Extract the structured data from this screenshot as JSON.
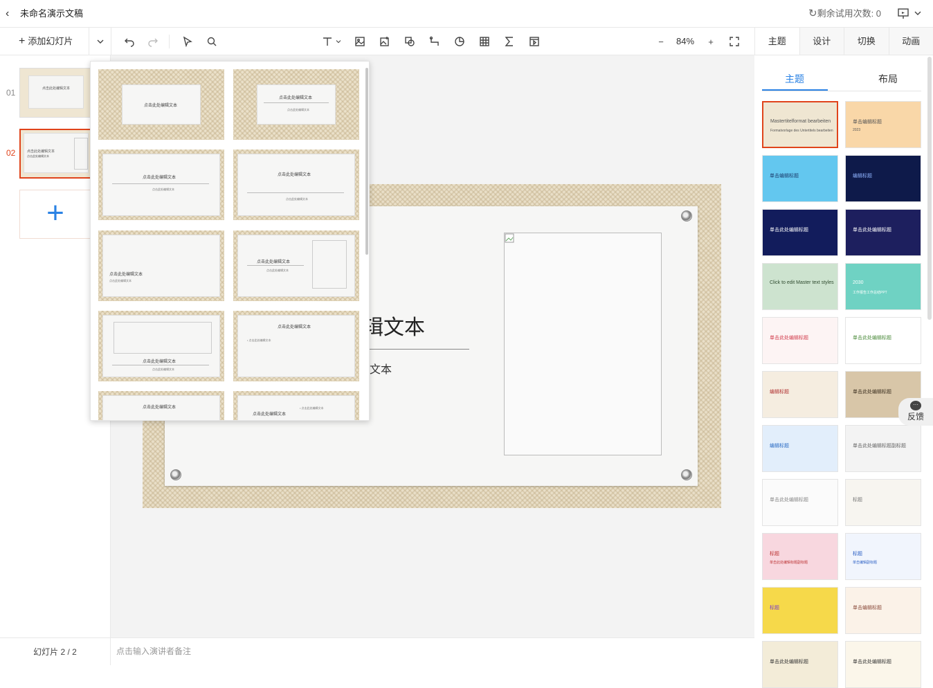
{
  "header": {
    "back_icon": "‹",
    "title": "未命名演示文稿",
    "trial_text": "剩余试用次数: 0",
    "refresh_icon": "↻",
    "present_icon": "present-icon"
  },
  "toolbar": {
    "add_slide_label": "添加幻灯片",
    "plus": "+",
    "zoom_minus": "−",
    "zoom_value": "84%",
    "zoom_plus": "+"
  },
  "right_tabs": [
    "主题",
    "设计",
    "切换",
    "动画"
  ],
  "right_subtabs": [
    "主题",
    "布局"
  ],
  "slides": [
    {
      "num": "01",
      "thumb_text": "点击此处编辑文本"
    },
    {
      "num": "02",
      "thumb_text": "点击此处编辑文本",
      "thumb_sub": "点击此处编辑文本"
    }
  ],
  "add_slide_plus": "+",
  "status": "幻灯片 2 / 2",
  "notes_placeholder": "点击输入演讲者备注",
  "slide": {
    "title_partial": "辑文本",
    "subtitle_partial": "文本"
  },
  "layouts": {
    "title": "点击此处编辑文本",
    "sub": "点击此处编辑文本",
    "bullet": "• 点击此处编辑文本"
  },
  "themes": [
    {
      "title": "Mastertitelformat bearbeiten",
      "sub": "Formatvorlage des Untertitels bearbeiten",
      "bg": "#efe6d2",
      "fg": "#555"
    },
    {
      "title": "单击编辑标题",
      "sub": "2023",
      "bg": "#f9d7a8",
      "fg": "#555"
    },
    {
      "title": "单击编辑标题",
      "sub": "",
      "bg": "#63c7ef",
      "fg": "#1b3b6b"
    },
    {
      "title": "编辑标题",
      "sub": "",
      "bg": "#0e1a4a",
      "fg": "#8fb4ff"
    },
    {
      "title": "单击此处编辑标题",
      "sub": "",
      "bg": "#121c5c",
      "fg": "#fff"
    },
    {
      "title": "单击此处编辑标题",
      "sub": "",
      "bg": "#1d1f5e",
      "fg": "#fff"
    },
    {
      "title": "Click to edit Master text styles",
      "sub": "",
      "bg": "#cde3cf",
      "fg": "#2e4a2e"
    },
    {
      "title": "2030",
      "sub": "工作报告工作总结PPT",
      "bg": "#6fd2c3",
      "fg": "#fff"
    },
    {
      "title": "单击此处编辑标题",
      "sub": "",
      "bg": "#fdf4f4",
      "fg": "#d23a4a"
    },
    {
      "title": "单击此处编辑标题",
      "sub": "",
      "bg": "#ffffff",
      "fg": "#4a8a3a"
    },
    {
      "title": "编辑标题",
      "sub": "",
      "bg": "#f5ede0",
      "fg": "#b03030"
    },
    {
      "title": "单击此处编辑标题",
      "sub": "",
      "bg": "#d8c6a8",
      "fg": "#3a2e1e"
    },
    {
      "title": "编辑标题",
      "sub": "",
      "bg": "#e2eefb",
      "fg": "#2a6bc4"
    },
    {
      "title": "单击此处编辑标题副标题",
      "sub": "",
      "bg": "#f3f3f3",
      "fg": "#666"
    },
    {
      "title": "单击此处编辑标题",
      "sub": "",
      "bg": "#fbfbfb",
      "fg": "#888"
    },
    {
      "title": "标题",
      "sub": "",
      "bg": "#f7f5f0",
      "fg": "#777"
    },
    {
      "title": "标题",
      "sub": "单击此处编辑标题副标题",
      "bg": "#f8d7df",
      "fg": "#b33"
    },
    {
      "title": "标题",
      "sub": "单击编辑副标题",
      "bg": "#f1f5fd",
      "fg": "#2a5fc4"
    },
    {
      "title": "标题",
      "sub": "",
      "bg": "#f6d94a",
      "fg": "#7a3ad0"
    },
    {
      "title": "单击编辑标题",
      "sub": "",
      "bg": "#fbf2e8",
      "fg": "#8a4a3a"
    },
    {
      "title": "单击此处编辑标题",
      "sub": "",
      "bg": "#f3ecd8",
      "fg": "#333"
    },
    {
      "title": "单击此处编辑标题",
      "sub": "",
      "bg": "#fbf6ea",
      "fg": "#333"
    }
  ],
  "feedback_label": "反馈"
}
